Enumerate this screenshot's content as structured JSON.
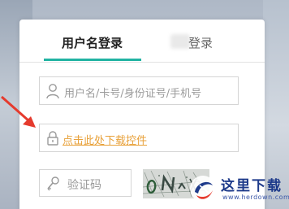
{
  "tabs": {
    "account_login": "用户名登录",
    "other_login_partial": "登录"
  },
  "form": {
    "username_placeholder": "用户名/卡号/身份证号/手机号",
    "plugin_link": "点击此处下载控件",
    "captcha_placeholder": "验证码"
  },
  "watermark": {
    "title": "这里下载",
    "url": "www.herdown.com"
  },
  "colors": {
    "accent": "#21b3a2",
    "plugin_link": "#e8a13a",
    "arrow": "#e53b2e",
    "watermark": "#1d3a8a"
  },
  "icons": {
    "user": "user-icon",
    "lock": "lock-icon",
    "key": "key-icon",
    "arrow": "red-arrow-icon"
  }
}
